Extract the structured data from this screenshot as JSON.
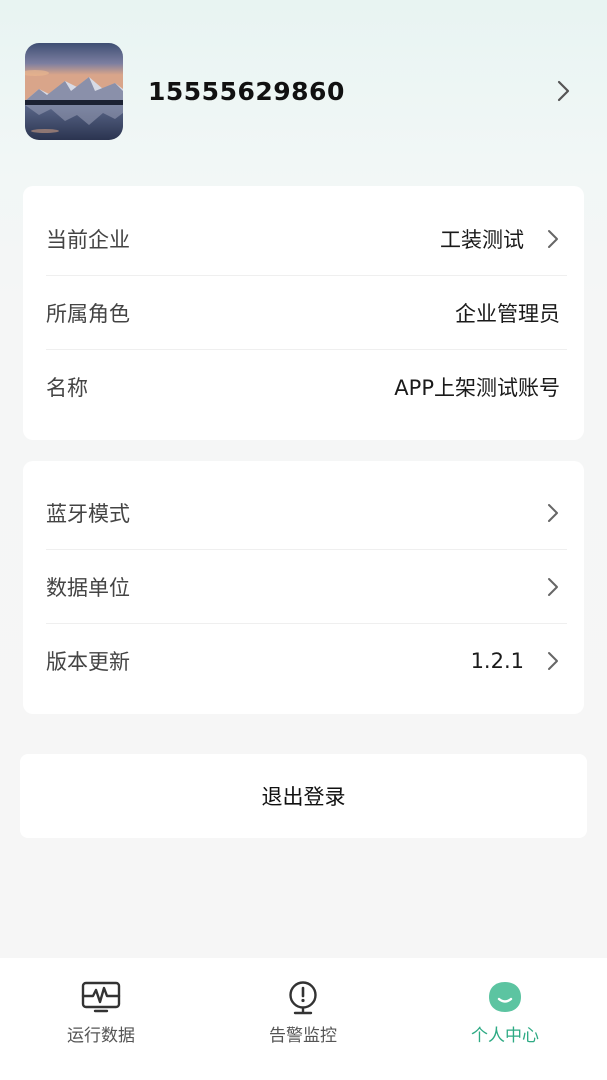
{
  "profile": {
    "phone": "15555629860",
    "avatar_icon": "mountain-lake-photo"
  },
  "account_card": {
    "rows": [
      {
        "label": "当前企业",
        "value": "工装测试",
        "has_chevron": true
      },
      {
        "label": "所属角色",
        "value": "企业管理员",
        "has_chevron": false
      },
      {
        "label": "名称",
        "value": "APP上架测试账号",
        "has_chevron": false
      }
    ]
  },
  "settings_card": {
    "rows": [
      {
        "label": "蓝牙模式",
        "value": "",
        "has_chevron": true
      },
      {
        "label": "数据单位",
        "value": "",
        "has_chevron": true
      },
      {
        "label": "版本更新",
        "value": "1.2.1",
        "has_chevron": true
      }
    ]
  },
  "logout": {
    "label": "退出登录"
  },
  "tabbar": {
    "tabs": [
      {
        "label": "运行数据",
        "icon": "waveform-monitor-icon",
        "active": false
      },
      {
        "label": "告警监控",
        "icon": "alarm-monitor-icon",
        "active": false
      },
      {
        "label": "个人中心",
        "icon": "personal-center-icon",
        "active": true
      }
    ]
  },
  "colors": {
    "accent": "#2eaa84",
    "background": "#f6f6f6",
    "card": "#ffffff"
  }
}
